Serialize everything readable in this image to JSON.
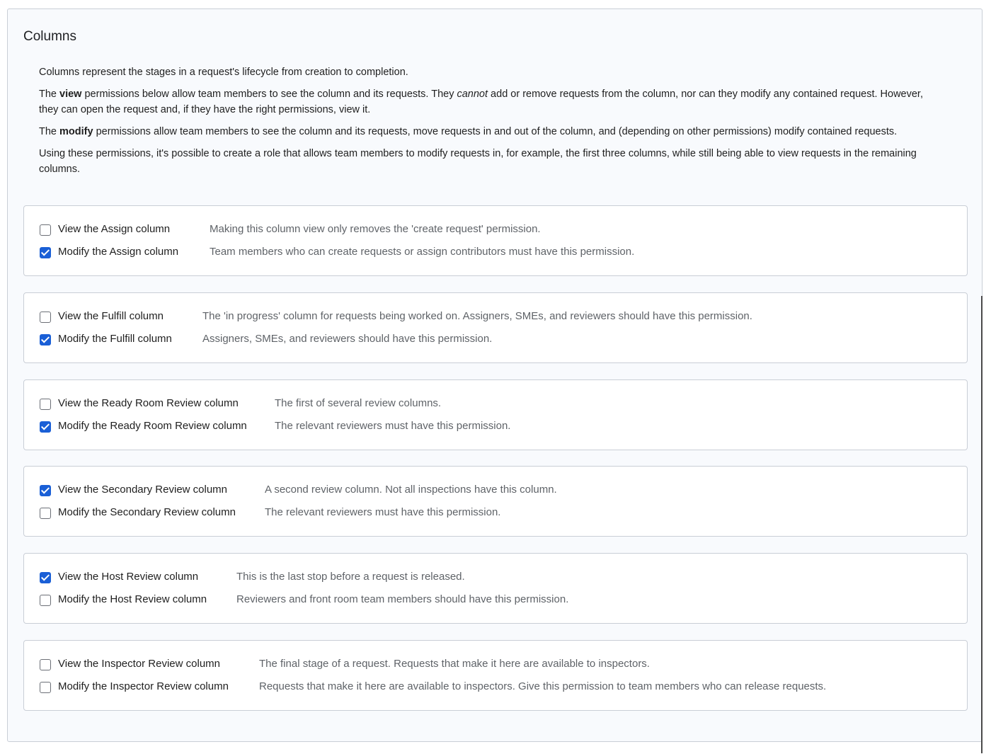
{
  "section": {
    "title": "Columns"
  },
  "description": {
    "p1": "Columns represent the stages in a request's lifecycle from creation to completion.",
    "p2": {
      "pre": "The ",
      "strong": "view",
      "mid": " permissions below allow team members to see the column and its requests. They ",
      "em": "cannot",
      "post": " add or remove requests from the column, nor can they modify any contained request. However, they can open the request and, if they have the right permissions, view it."
    },
    "p3": {
      "pre": "The ",
      "strong": "modify",
      "post": " permissions allow team members to see the column and its requests, move requests in and out of the column, and (depending on other permissions) modify contained requests."
    },
    "p4": "Using these permissions, it's possible to create a role that allows team members to modify requests in, for example, the first three columns, while still being able to view requests in the remaining columns."
  },
  "groups": [
    {
      "view": {
        "label": "View the Assign column",
        "checked": false,
        "help": "Making this column view only removes the 'create request' permission."
      },
      "modify": {
        "label": "Modify the Assign column",
        "checked": true,
        "help": "Team members who can create requests or assign contributors must have this permission."
      }
    },
    {
      "view": {
        "label": "View the Fulfill column",
        "checked": false,
        "help": "The 'in progress' column for requests being worked on. Assigners, SMEs, and reviewers should have this permission."
      },
      "modify": {
        "label": "Modify the Fulfill column",
        "checked": true,
        "help": "Assigners, SMEs, and reviewers should have this permission."
      }
    },
    {
      "view": {
        "label": "View the Ready Room Review column",
        "checked": false,
        "help": "The first of several review columns."
      },
      "modify": {
        "label": "Modify the Ready Room Review column",
        "checked": true,
        "help": "The relevant reviewers must have this permission."
      }
    },
    {
      "view": {
        "label": "View the Secondary Review column",
        "checked": true,
        "help": "A second review column. Not all inspections have this column."
      },
      "modify": {
        "label": "Modify the Secondary Review column",
        "checked": false,
        "help": "The relevant reviewers must have this permission."
      }
    },
    {
      "view": {
        "label": "View the Host Review column",
        "checked": true,
        "help": "This is the last stop before a request is released."
      },
      "modify": {
        "label": "Modify the Host Review column",
        "checked": false,
        "help": "Reviewers and front room team members should have this permission."
      }
    },
    {
      "view": {
        "label": "View the Inspector Review column",
        "checked": false,
        "help": "The final stage of a request. Requests that make it here are available to inspectors."
      },
      "modify": {
        "label": "Modify the Inspector Review column",
        "checked": false,
        "help": "Requests that make it here are available to inspectors. Give this permission to team members who can release requests."
      }
    }
  ],
  "colors": {
    "checkbox_checked": "#1a5fd6",
    "help_text": "#5f6368",
    "panel_bg": "#f8fafd"
  }
}
